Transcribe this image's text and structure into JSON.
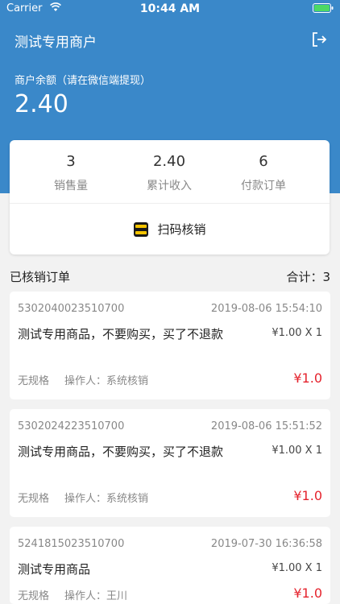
{
  "status_bar": {
    "carrier": "Carrier",
    "time": "10:44 AM"
  },
  "header": {
    "title": "测试专用商户",
    "balance_label": "商户余额（请在微信端提现）",
    "balance": "2.40"
  },
  "stats": [
    {
      "value": "3",
      "label": "销售量"
    },
    {
      "value": "2.40",
      "label": "累计收入"
    },
    {
      "value": "6",
      "label": "付款订单"
    }
  ],
  "scan_button": {
    "label": "扫码核销"
  },
  "orders_header": {
    "title": "已核销订单",
    "total_label": "合计：3"
  },
  "orders": [
    {
      "id": "5302040023510700",
      "time": "2019-08-06 15:54:10",
      "name": "测试专用商品，不要购买，买了不退款",
      "qty": "¥1.00 X 1",
      "spec": "无规格",
      "operator": "操作人：系统核销",
      "price": "¥1.0"
    },
    {
      "id": "5302024223510700",
      "time": "2019-08-06 15:51:52",
      "name": "测试专用商品，不要购买，买了不退款",
      "qty": "¥1.00 X 1",
      "spec": "无规格",
      "operator": "操作人：系统核销",
      "price": "¥1.0"
    },
    {
      "id": "5241815023510700",
      "time": "2019-07-30 16:36:58",
      "name": "测试专用商品",
      "qty": "¥1.00 X 1",
      "spec": "无规格",
      "operator": "操作人：王川",
      "price": "¥1.0"
    }
  ],
  "colors": {
    "header_bg": "#3a88c9",
    "price": "#e5232d",
    "scan_icon": "#f5c400"
  },
  "icons": {
    "logout": "logout-icon",
    "scan": "scan-icon",
    "wifi": "wifi-icon",
    "battery": "battery-icon"
  }
}
